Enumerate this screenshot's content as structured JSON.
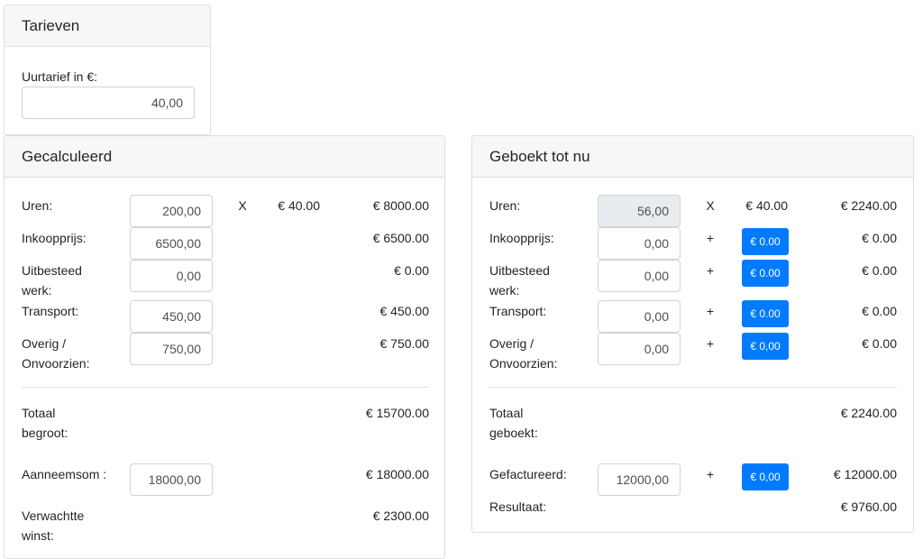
{
  "tarieven": {
    "title": "Tarieven",
    "rate_label": "Uurtarief in €:",
    "rate_value": "40,00"
  },
  "gecalculeerd": {
    "title": "Gecalculeerd",
    "rows": [
      {
        "label": "Uren:",
        "input": "200,00",
        "op": "X",
        "rate": "€ 40.00",
        "total": "€ 8000.00"
      },
      {
        "label": "Inkoopprijs:",
        "input": "6500,00",
        "total": "€ 6500.00"
      },
      {
        "label": "Uitbesteed werk:",
        "input": "0,00",
        "total": "€ 0.00"
      },
      {
        "label": "Transport:",
        "input": "450,00",
        "total": "€ 450.00"
      },
      {
        "label": "Overig / Onvoorzien:",
        "input": "750,00",
        "total": "€ 750.00"
      }
    ],
    "totaal_label": "Totaal begroot:",
    "totaal_value": "€ 15700.00",
    "aanneemsom_label": "Aanneemsom :",
    "aanneemsom_input": "18000,00",
    "aanneemsom_value": "€ 18000.00",
    "winst_label": "Verwachtte winst:",
    "winst_value": "€ 2300.00"
  },
  "geboekt": {
    "title": "Geboekt tot nu",
    "rows": [
      {
        "label": "Uren:",
        "input": "56,00",
        "op": "X",
        "rate": "€ 40.00",
        "total": "€ 2240.00"
      },
      {
        "label": "Inkoopprijs:",
        "input": "0,00",
        "op": "+",
        "button": "€ 0.00",
        "total": "€ 0.00"
      },
      {
        "label": "Uitbesteed werk:",
        "input": "0,00",
        "op": "+",
        "button": "€ 0.00",
        "total": "€ 0.00"
      },
      {
        "label": "Transport:",
        "input": "0,00",
        "op": "+",
        "button": "€ 0.00",
        "total": "€ 0.00"
      },
      {
        "label": "Overig / Onvoorzien:",
        "input": "0,00",
        "op": "+",
        "button": "€ 0,00",
        "total": "€ 0.00"
      }
    ],
    "totaal_label": "Totaal geboekt:",
    "totaal_value": "€ 2240.00",
    "gefactureerd_label": "Gefactureerd:",
    "gefactureerd_input": "12000,00",
    "gefactureerd_op": "+",
    "gefactureerd_button": "€ 0,00",
    "gefactureerd_value": "€ 12000.00",
    "resultaat_label": "Resultaat:",
    "resultaat_value": "€ 9760.00"
  },
  "colors": {
    "accent": "#007bff",
    "header_bg": "#f7f7f7",
    "readonly_bg": "#e9ecef"
  }
}
